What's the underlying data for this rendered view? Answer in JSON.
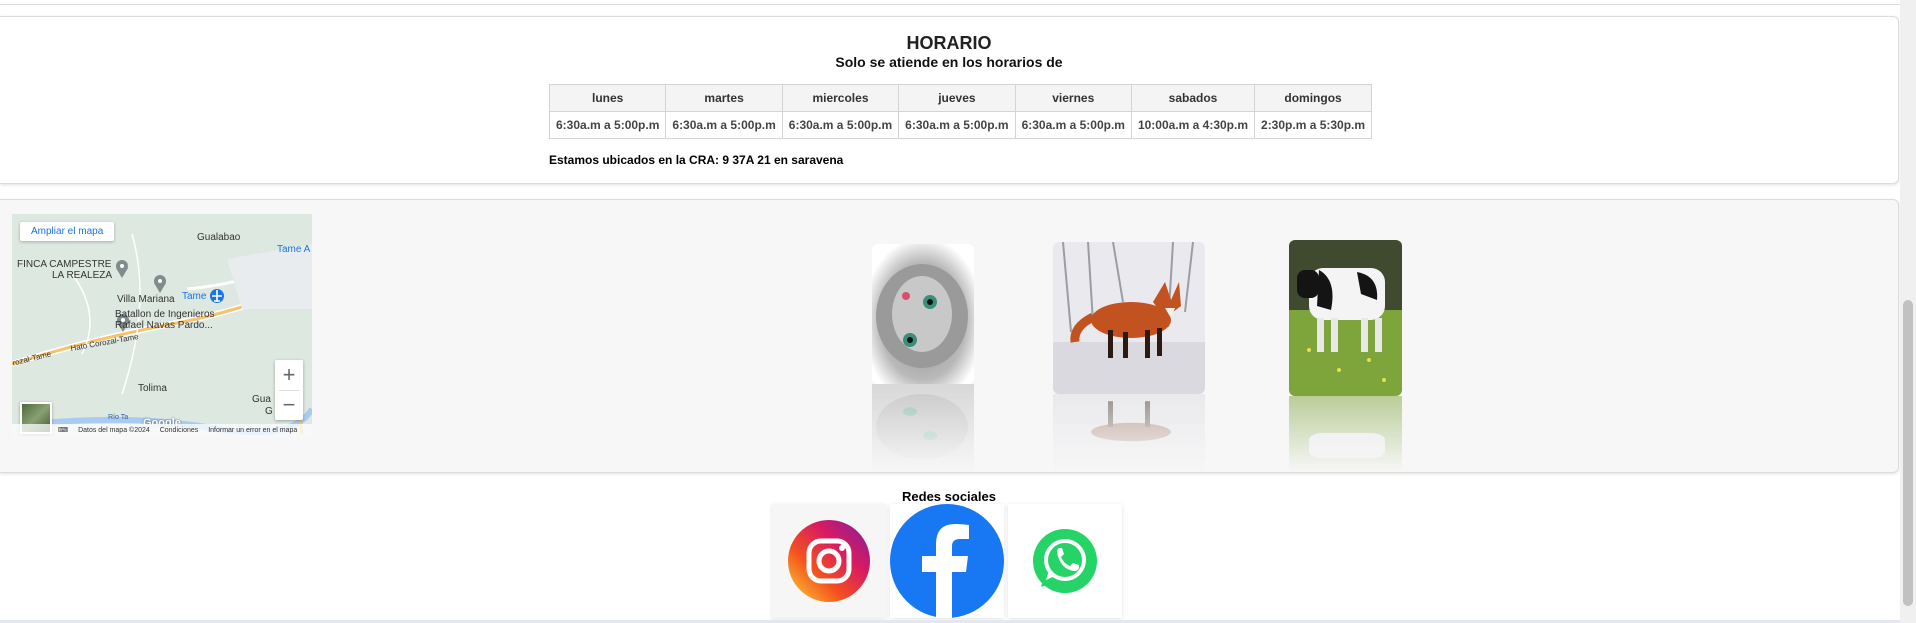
{
  "schedule": {
    "title": "HORARIO",
    "subtitle": "Solo se atiende en los horarios de",
    "days": [
      "lunes",
      "martes",
      "miercoles",
      "jueves",
      "viernes",
      "sabados",
      "domingos"
    ],
    "hours": [
      "6:30a.m a 5:00p.m",
      "6:30a.m a 5:00p.m",
      "6:30a.m a 5:00p.m",
      "6:30a.m a 5:00p.m",
      "6:30a.m a 5:00p.m",
      "10:00a.m a 4:30p.m",
      "2:30p.m a 5:30p.m"
    ],
    "location": "Estamos ubicados en la CRA: 9 37A 21 en saravena"
  },
  "map": {
    "expand_label": "Ampliar el mapa",
    "labels": {
      "gualabao": "Gualabao",
      "tame_a": "Tame A",
      "finca1": "FINCA CAMPESTRE",
      "finca2": "LA REALEZA",
      "villa": "Villa Mariana",
      "tame": "Tame",
      "batallon1": "Batallon de Ingenieros",
      "batallon2": "Rafael Navas Pardo...",
      "road": "Hato Corozal-Tame",
      "road_left": "rozal-Tame",
      "tolima": "Tolima",
      "gua1": "Gua",
      "gua2": "G",
      "rio": "Río Ta"
    },
    "zoom_in": "+",
    "zoom_out": "−",
    "logo": "Google",
    "footer": [
      "Datos del mapa ©2024",
      "Condiciones",
      "Informar un error en el mapa"
    ],
    "colors": {
      "land": "#dde8e1",
      "road": "#f6c26b",
      "water": "#aacbf0",
      "pin": "#7f8c8d",
      "airport": "#1a73e8"
    }
  },
  "gallery": {
    "images": [
      "kitten-photo",
      "fox-photo",
      "cow-photo"
    ]
  },
  "social": {
    "title": "Redes sociales",
    "networks": [
      "instagram",
      "facebook",
      "whatsapp"
    ],
    "colors": {
      "facebook": "#1877f2",
      "whatsapp": "#25d366"
    }
  }
}
